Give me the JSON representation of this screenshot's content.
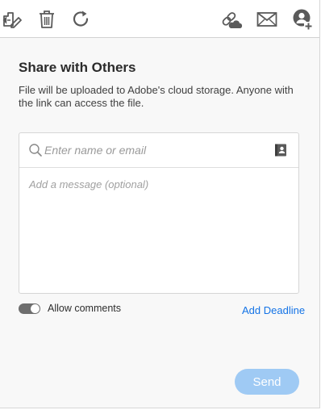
{
  "toolbar": {
    "icons": [
      "edit-pages-icon",
      "trash-icon",
      "rotate-icon",
      "cloud-link-icon",
      "envelope-icon",
      "add-person-icon"
    ]
  },
  "panel": {
    "title": "Share with Others",
    "description": "File will be uploaded to Adobe's cloud storage. Anyone with the link can access the file."
  },
  "recipient": {
    "placeholder": "Enter name or email",
    "value": ""
  },
  "message": {
    "placeholder": "Add a message (optional)",
    "value": ""
  },
  "comments": {
    "label": "Allow comments",
    "enabled": true
  },
  "deadline": {
    "label": "Add Deadline"
  },
  "send": {
    "label": "Send",
    "enabled": false
  },
  "colors": {
    "accent": "#1473e6",
    "send_disabled": "#9fcaf4",
    "toggle_on": "#6e6e6e",
    "icon": "#5a5a5a"
  }
}
